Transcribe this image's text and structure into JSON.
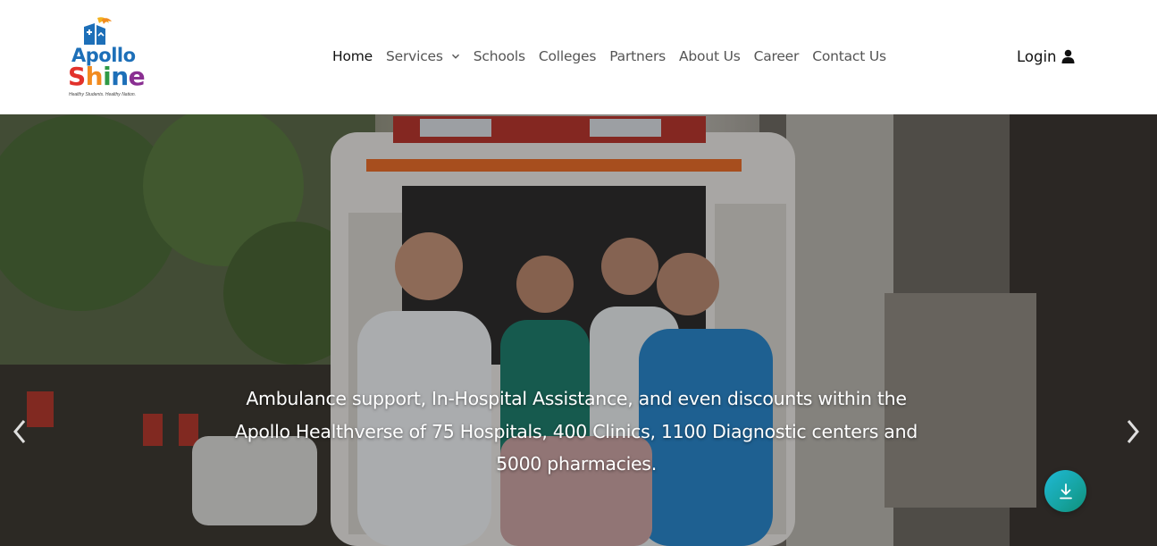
{
  "brand": {
    "name_top": "Apollo",
    "name_bottom_letters": [
      "S",
      "h",
      "i",
      "n",
      "e"
    ],
    "tagline": "Healthy Students. Healthy Nation.",
    "colors": {
      "blue": "#1d6fb8",
      "red": "#e2312b",
      "orange": "#f28b1f",
      "green": "#2f9a45",
      "purple": "#8a2f92"
    }
  },
  "nav": {
    "items": [
      {
        "label": "Home",
        "active": true
      },
      {
        "label": "Services",
        "dropdown": true
      },
      {
        "label": "Schools"
      },
      {
        "label": "Colleges"
      },
      {
        "label": "Partners"
      },
      {
        "label": "About Us"
      },
      {
        "label": "Career"
      },
      {
        "label": "Contact Us"
      }
    ]
  },
  "login": {
    "label": "Login",
    "icon": "user-icon"
  },
  "hero": {
    "caption_lines": [
      "Ambulance support, In-Hospital Assistance, and even discounts within the",
      "Apollo Healthverse of 75 Hospitals, 400 Clinics, 1100 Diagnostic centers and",
      "5000 pharmacies."
    ],
    "prev_icon": "chevron-left-icon",
    "next_icon": "chevron-right-icon"
  },
  "scroll_button": {
    "icon": "download-arrow-icon",
    "color": "#16a3a0"
  }
}
